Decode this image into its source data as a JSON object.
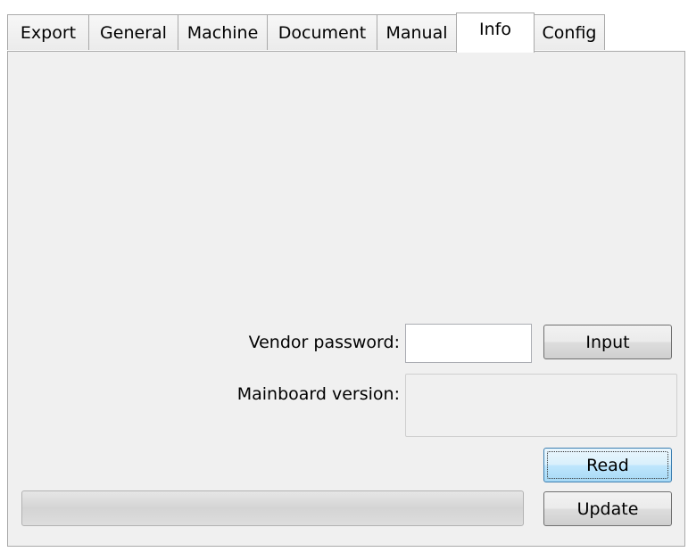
{
  "tabs": [
    {
      "label": "Export",
      "active": false
    },
    {
      "label": "General",
      "active": false
    },
    {
      "label": "Machine",
      "active": false
    },
    {
      "label": "Document",
      "active": false
    },
    {
      "label": "Manual",
      "active": false
    },
    {
      "label": "Info",
      "active": true
    },
    {
      "label": "Config",
      "active": false
    }
  ],
  "info": {
    "vendor_password_label": "Vendor password:",
    "vendor_password_value": "",
    "input_button": "Input",
    "mainboard_version_label": "Mainboard version:",
    "mainboard_version_value": "",
    "read_button": "Read",
    "update_button": "Update",
    "progress": 0
  }
}
